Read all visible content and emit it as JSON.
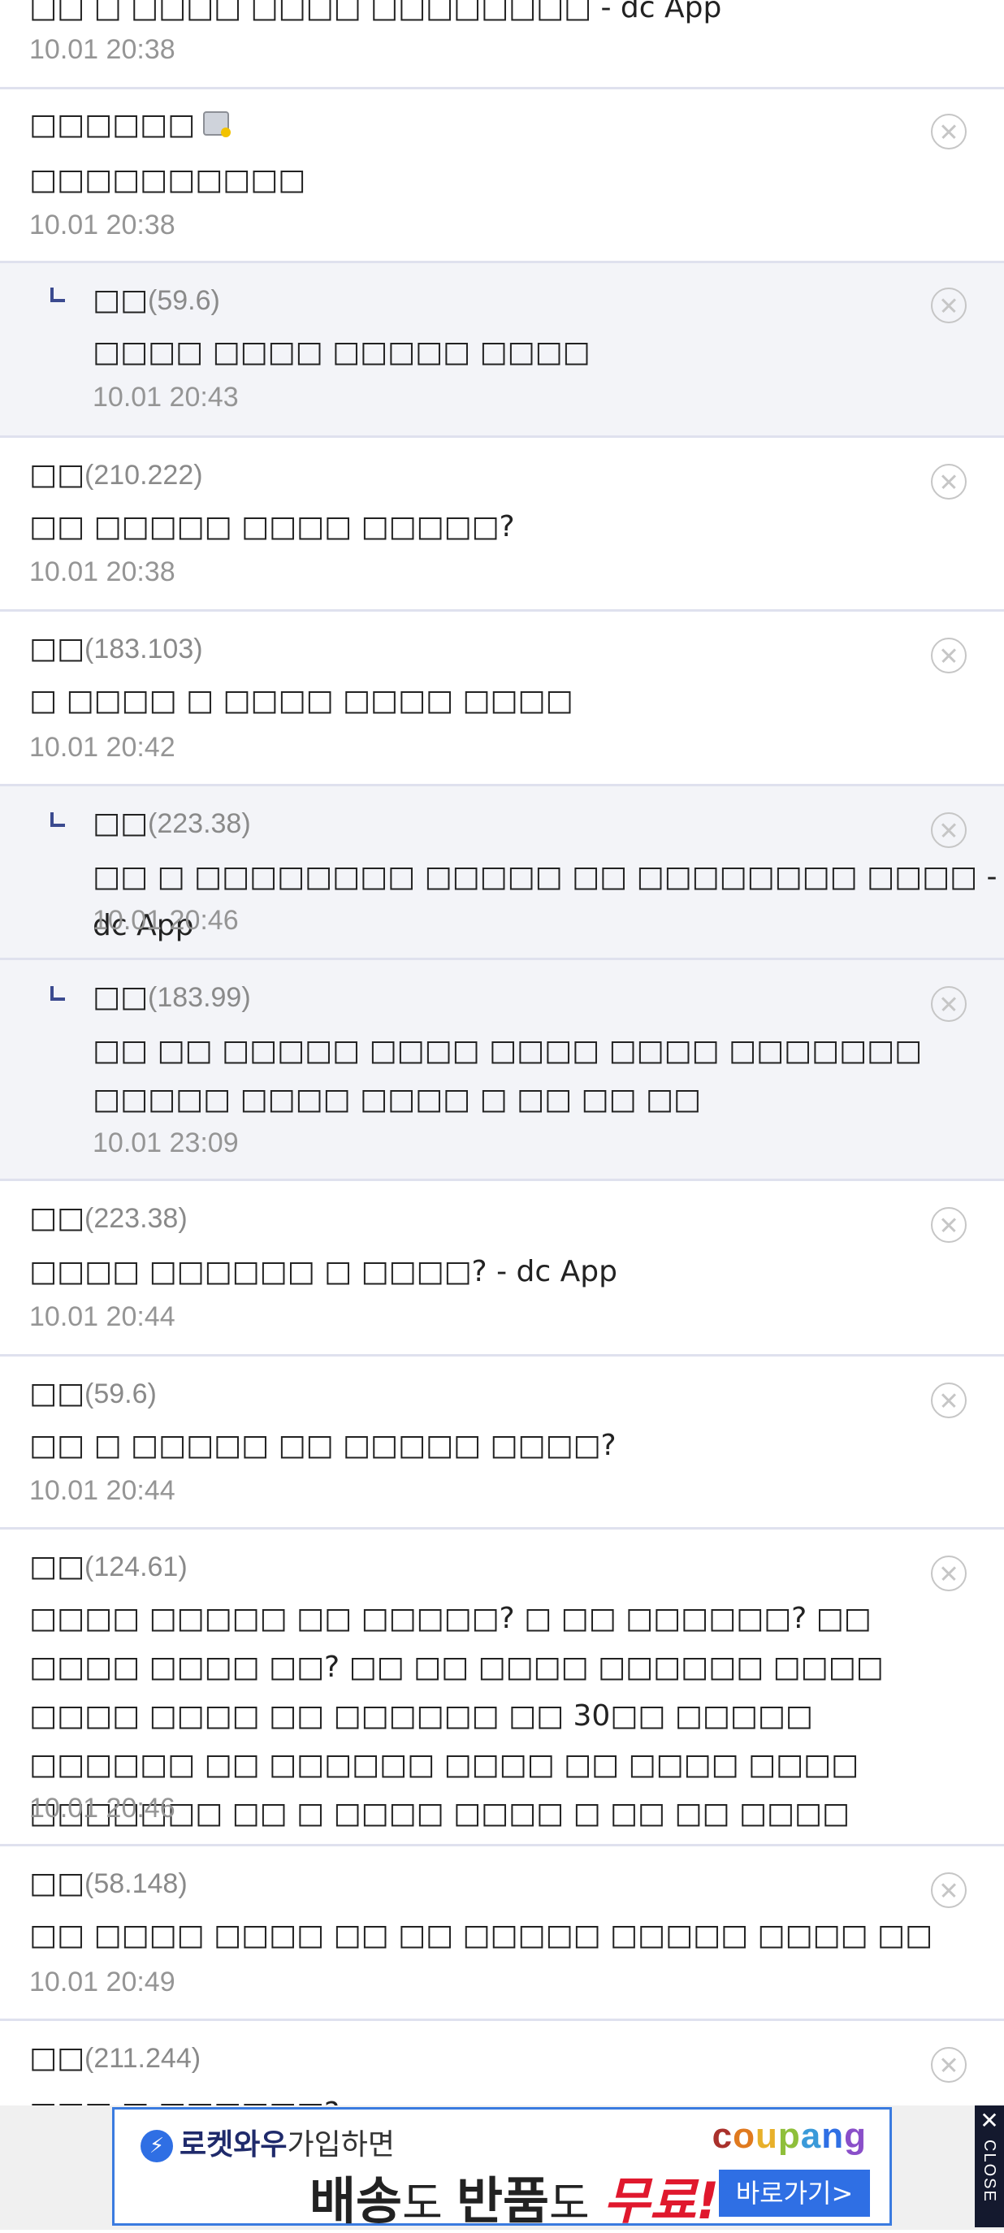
{
  "comments": [
    {
      "text": "□□ □ □□□□ □□□□ □□□□□□□□ - dc App",
      "time": "10.01 20:38"
    },
    {
      "nick": "□□□□□□",
      "text": "□□□□□□□□□□",
      "time": "10.01 20:38"
    },
    {
      "nick": "□□",
      "ip": "(59.6)",
      "text": "□□□□ □□□□ □□□□□ □□□□",
      "time": "10.01 20:43"
    },
    {
      "nick": "□□",
      "ip": "(210.222)",
      "text": "□□ □□□□□ □□□□ □□□□□?",
      "time": "10.01 20:38"
    },
    {
      "nick": "□□",
      "ip": "(183.103)",
      "text": "□ □□□□ □ □□□□ □□□□ □□□□",
      "time": "10.01 20:42"
    },
    {
      "nick": "□□",
      "ip": "(223.38)",
      "text": "□□ □ □□□□□□□□ □□□□□ □□ □□□□□□□□ □□□□ - dc App",
      "time": "10.01 20:46"
    },
    {
      "nick": "□□",
      "ip": "(183.99)",
      "text": "□□ □□ □□□□□ □□□□ □□□□ □□□□ □□□□□□□ □□□□□ □□□□ □□□□ □ □□ □□ □□",
      "time": "10.01 23:09"
    },
    {
      "nick": "□□",
      "ip": "(223.38)",
      "text": "□□□□ □□□□□□ □ □□□□? - dc App",
      "time": "10.01 20:44"
    },
    {
      "nick": "□□",
      "ip": "(59.6)",
      "text": "□□ □ □□□□□ □□ □□□□□ □□□□?",
      "time": "10.01 20:44"
    },
    {
      "nick": "□□",
      "ip": "(124.61)",
      "text": "□□□□ □□□□□ □□ □□□□□? □ □□ □□□□□□? □□ □□□□ □□□□ □□? □□ □□ □□□□ □□□□□□ □□□□ □□□□ □□□□ □□ □□□□□□ □□ 30□□ □□□□□ □□□□□□ □□ □□□□□□ □□□□ □□ □□□□ □□□□ □□□□□□□ □□ □ □□□□ □□□□ □ □□ □□ □□□□ □□□□□ □ □ □□?",
      "time": "10.01 20:46"
    },
    {
      "nick": "□□",
      "ip": "(58.148)",
      "text": "□□ □□□□ □□□□ □□ □□ □□□□□ □□□□□ □□□□ □□",
      "time": "10.01 20:49"
    },
    {
      "nick": "□□",
      "ip": "(211.244)",
      "text": "□□□ □ □□□□□□?",
      "time": ""
    }
  ],
  "ad": {
    "brand_line": "로켓와우",
    "brand_suffix": "가입하면",
    "logo": "coupang",
    "headline_a": "배송",
    "headline_b": "도 ",
    "headline_c": "반품",
    "headline_d": "도 ",
    "headline_e": "무료!",
    "cta": "바로가기>",
    "close_x": "✕",
    "close_label": "CLOSE"
  },
  "icons": {
    "delete": "circle-x-icon",
    "reply": "reply-arrow-icon",
    "badge": "gallog-icon"
  },
  "colors": {
    "reply_bg": "#f3f4f8",
    "divider": "#dfe1ee",
    "reply_arrow": "#3b4a8f",
    "ad_blue": "#2f6fe4",
    "ad_red": "#e0182d"
  }
}
